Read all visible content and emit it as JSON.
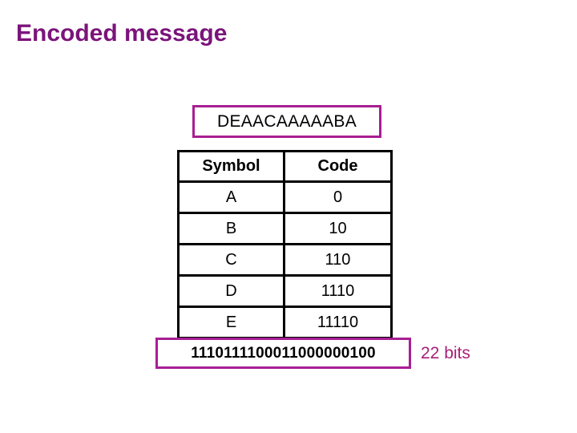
{
  "slide": {
    "title": "Encoded message",
    "title_color": "#7B147B",
    "background_color": "#FFFFFF",
    "accent_color": "#A81E93"
  },
  "encoded_message": {
    "label": "DEAACAAAAABA"
  },
  "code_table": {
    "headers": [
      "Symbol",
      "Code"
    ],
    "rows": [
      {
        "symbol": "A",
        "code": "0"
      },
      {
        "symbol": "B",
        "code": "10"
      },
      {
        "symbol": "C",
        "code": "110"
      },
      {
        "symbol": "D",
        "code": "1110"
      },
      {
        "symbol": "E",
        "code": "11110"
      }
    ]
  },
  "encoded_bits": {
    "value": "1110111100011000000100",
    "count_label": "22 bits"
  }
}
